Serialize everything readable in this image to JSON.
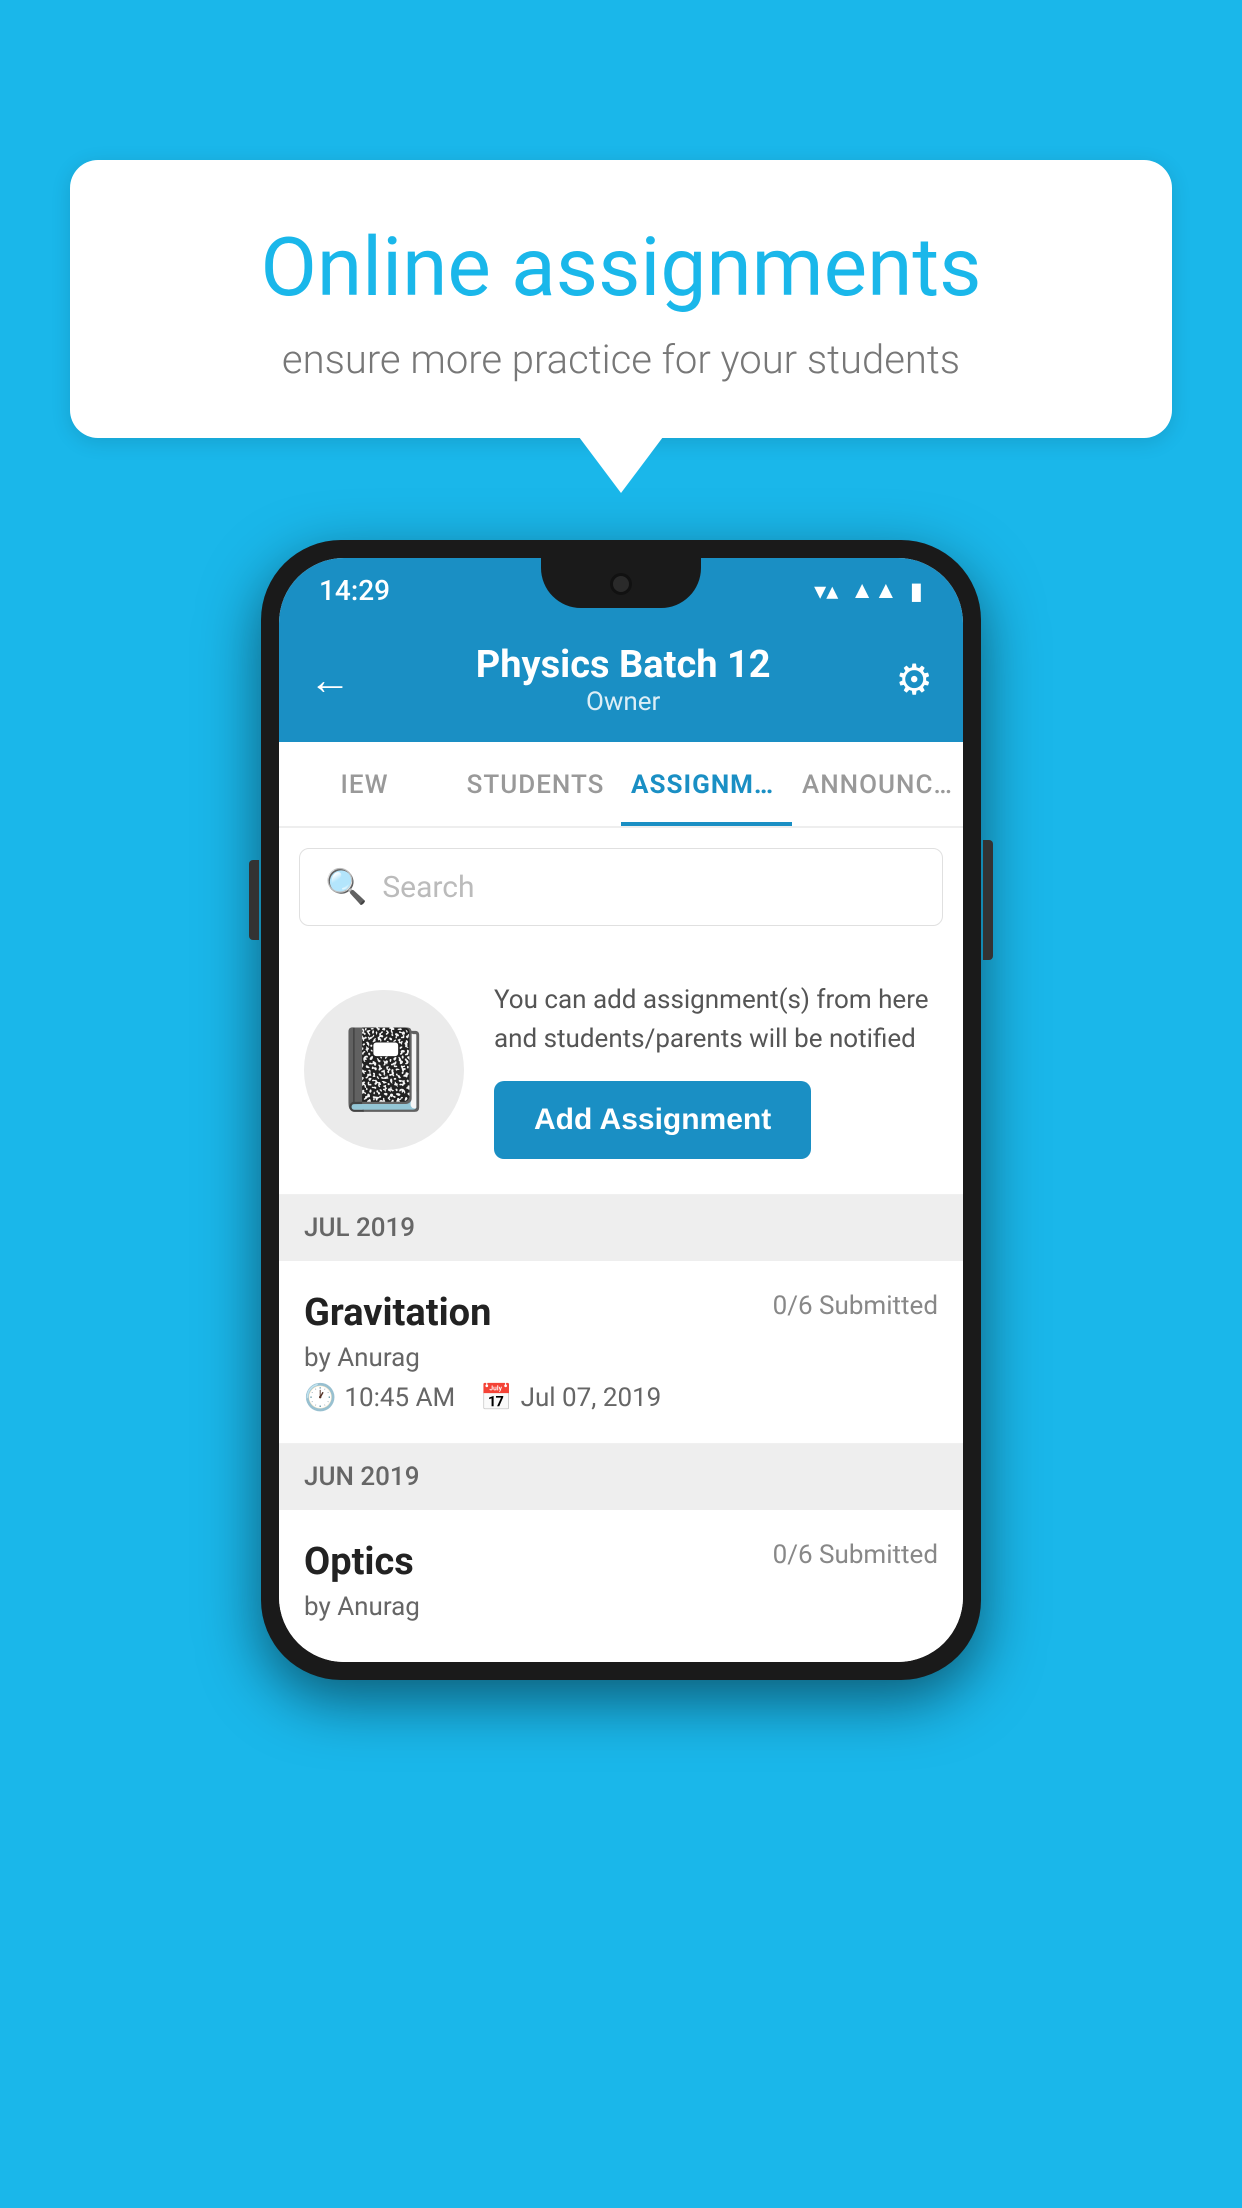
{
  "background_color": "#1ab7ea",
  "speech_bubble": {
    "title": "Online assignments",
    "subtitle": "ensure more practice for your students"
  },
  "phone": {
    "status_bar": {
      "time": "14:29",
      "icons": [
        "wifi",
        "signal",
        "battery"
      ]
    },
    "header": {
      "title": "Physics Batch 12",
      "subtitle": "Owner",
      "back_label": "←",
      "settings_label": "⚙"
    },
    "tabs": [
      {
        "label": "IEW",
        "active": false
      },
      {
        "label": "STUDENTS",
        "active": false
      },
      {
        "label": "ASSIGNMENTS",
        "active": true
      },
      {
        "label": "ANNOUNCEM...",
        "active": false
      }
    ],
    "search": {
      "placeholder": "Search"
    },
    "promo": {
      "text": "You can add assignment(s) from here and students/parents will be notified",
      "button_label": "Add Assignment"
    },
    "sections": [
      {
        "label": "JUL 2019",
        "assignments": [
          {
            "name": "Gravitation",
            "status": "0/6 Submitted",
            "author": "by Anurag",
            "time": "10:45 AM",
            "date": "Jul 07, 2019"
          }
        ]
      },
      {
        "label": "JUN 2019",
        "assignments": [
          {
            "name": "Optics",
            "status": "0/6 Submitted",
            "author": "by Anurag",
            "time": "",
            "date": ""
          }
        ]
      }
    ]
  }
}
